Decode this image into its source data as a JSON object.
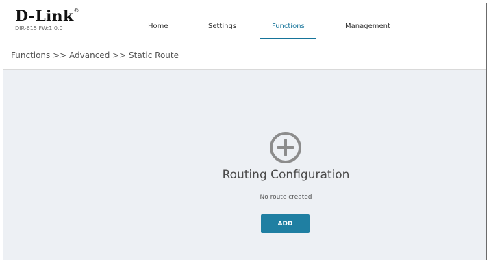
{
  "brand": {
    "logo": "D-Link",
    "model": "DIR-615 FW:1.0.0"
  },
  "nav": {
    "items": [
      {
        "label": "Home"
      },
      {
        "label": "Settings"
      },
      {
        "label": "Functions",
        "active": true
      },
      {
        "label": "Management"
      }
    ]
  },
  "breadcrumb": "Functions >> Advanced >> Static Route",
  "main": {
    "title": "Routing Configuration",
    "empty_note": "No route created",
    "add_label": "ADD"
  },
  "colors": {
    "accent": "#1f7fa2",
    "content_bg": "#edf0f4",
    "icon_gray": "#8c8c8c"
  },
  "icons": {
    "add_route": "plus-circle-icon"
  }
}
